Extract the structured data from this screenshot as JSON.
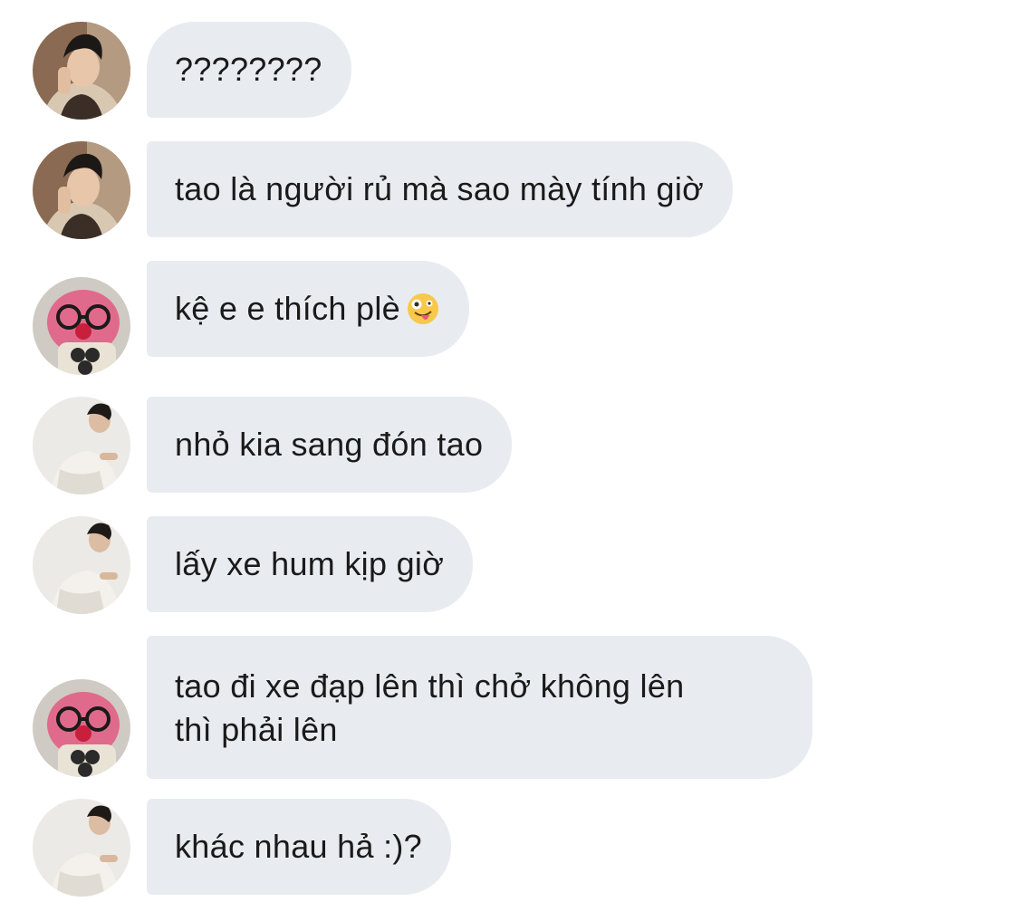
{
  "messages": [
    {
      "avatar": "avatar-man-hoodie",
      "text": "????????"
    },
    {
      "avatar": "avatar-man-hoodie",
      "text": "tao là người rủ mà sao mày tính giờ"
    },
    {
      "avatar": "avatar-pink-toy-glasses",
      "text": "kệ e e thích plè",
      "emoji": "zany-face-emoji"
    },
    {
      "avatar": "avatar-man-white-shirt",
      "text": "nhỏ kia sang đón tao"
    },
    {
      "avatar": "avatar-man-white-shirt",
      "text": "lấy xe hum kịp giờ"
    },
    {
      "avatar": "avatar-pink-toy-glasses",
      "text_line1": "tao đi xe đạp lên thì chở không lên",
      "text_line2": "thì phải lên"
    },
    {
      "avatar": "avatar-man-white-shirt",
      "text": "khác nhau hả :)?"
    }
  ],
  "colors": {
    "bubble_background": "#e8ecf0",
    "text": "#1a1a1a",
    "page_background": "#ffffff"
  }
}
